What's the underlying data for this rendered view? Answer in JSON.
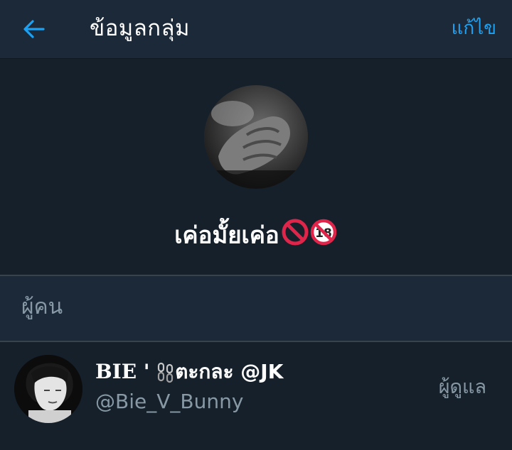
{
  "header": {
    "title": "ข้อมูลกลุ่ม",
    "edit_label": "แก้ไข",
    "back_icon": "arrow-left-icon",
    "accent_color": "#1da1f2"
  },
  "group": {
    "name": "เค่อมั้ยเค่อ",
    "emojis": [
      "no-entry-icon",
      "no-one-under-18-icon"
    ]
  },
  "people_section": {
    "title": "ผู้คน"
  },
  "members": [
    {
      "display_name_prefix": "BIE '",
      "display_name_suffix": "ตะกละ @JK",
      "name_icon": "chain-icon",
      "handle": "@Bie_V_Bunny",
      "role": "ผู้ดูแล"
    }
  ],
  "colors": {
    "background": "#15202b",
    "header_bg": "#1c2938",
    "secondary_text": "#8899a6",
    "divider": "#38444d"
  }
}
